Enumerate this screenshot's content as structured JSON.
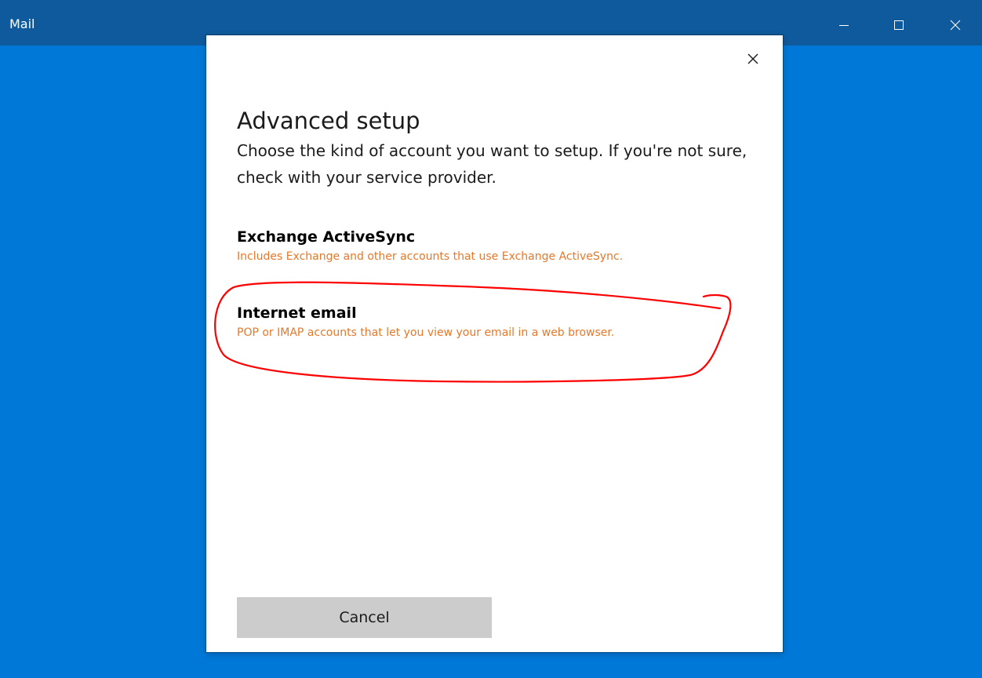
{
  "window": {
    "title": "Mail",
    "icons": {
      "minimize": "minimize-icon",
      "maximize": "maximize-icon",
      "close": "close-icon"
    }
  },
  "dialog": {
    "close_icon": "close-icon",
    "title": "Advanced setup",
    "description": "Choose the kind of account you want to setup. If you're not sure, check with your service provider.",
    "options": [
      {
        "title": "Exchange ActiveSync",
        "subtitle": "Includes Exchange and other accounts that use Exchange ActiveSync."
      },
      {
        "title": "Internet email",
        "subtitle": "POP or IMAP accounts that let you view your email in a web browser."
      }
    ],
    "cancel_label": "Cancel"
  },
  "colors": {
    "background": "#0078d7",
    "titlebar": "#0f5a9c",
    "option_subtitle": "#e5782a",
    "cancel_button": "#cccccc",
    "annotation": "#ff0000"
  }
}
